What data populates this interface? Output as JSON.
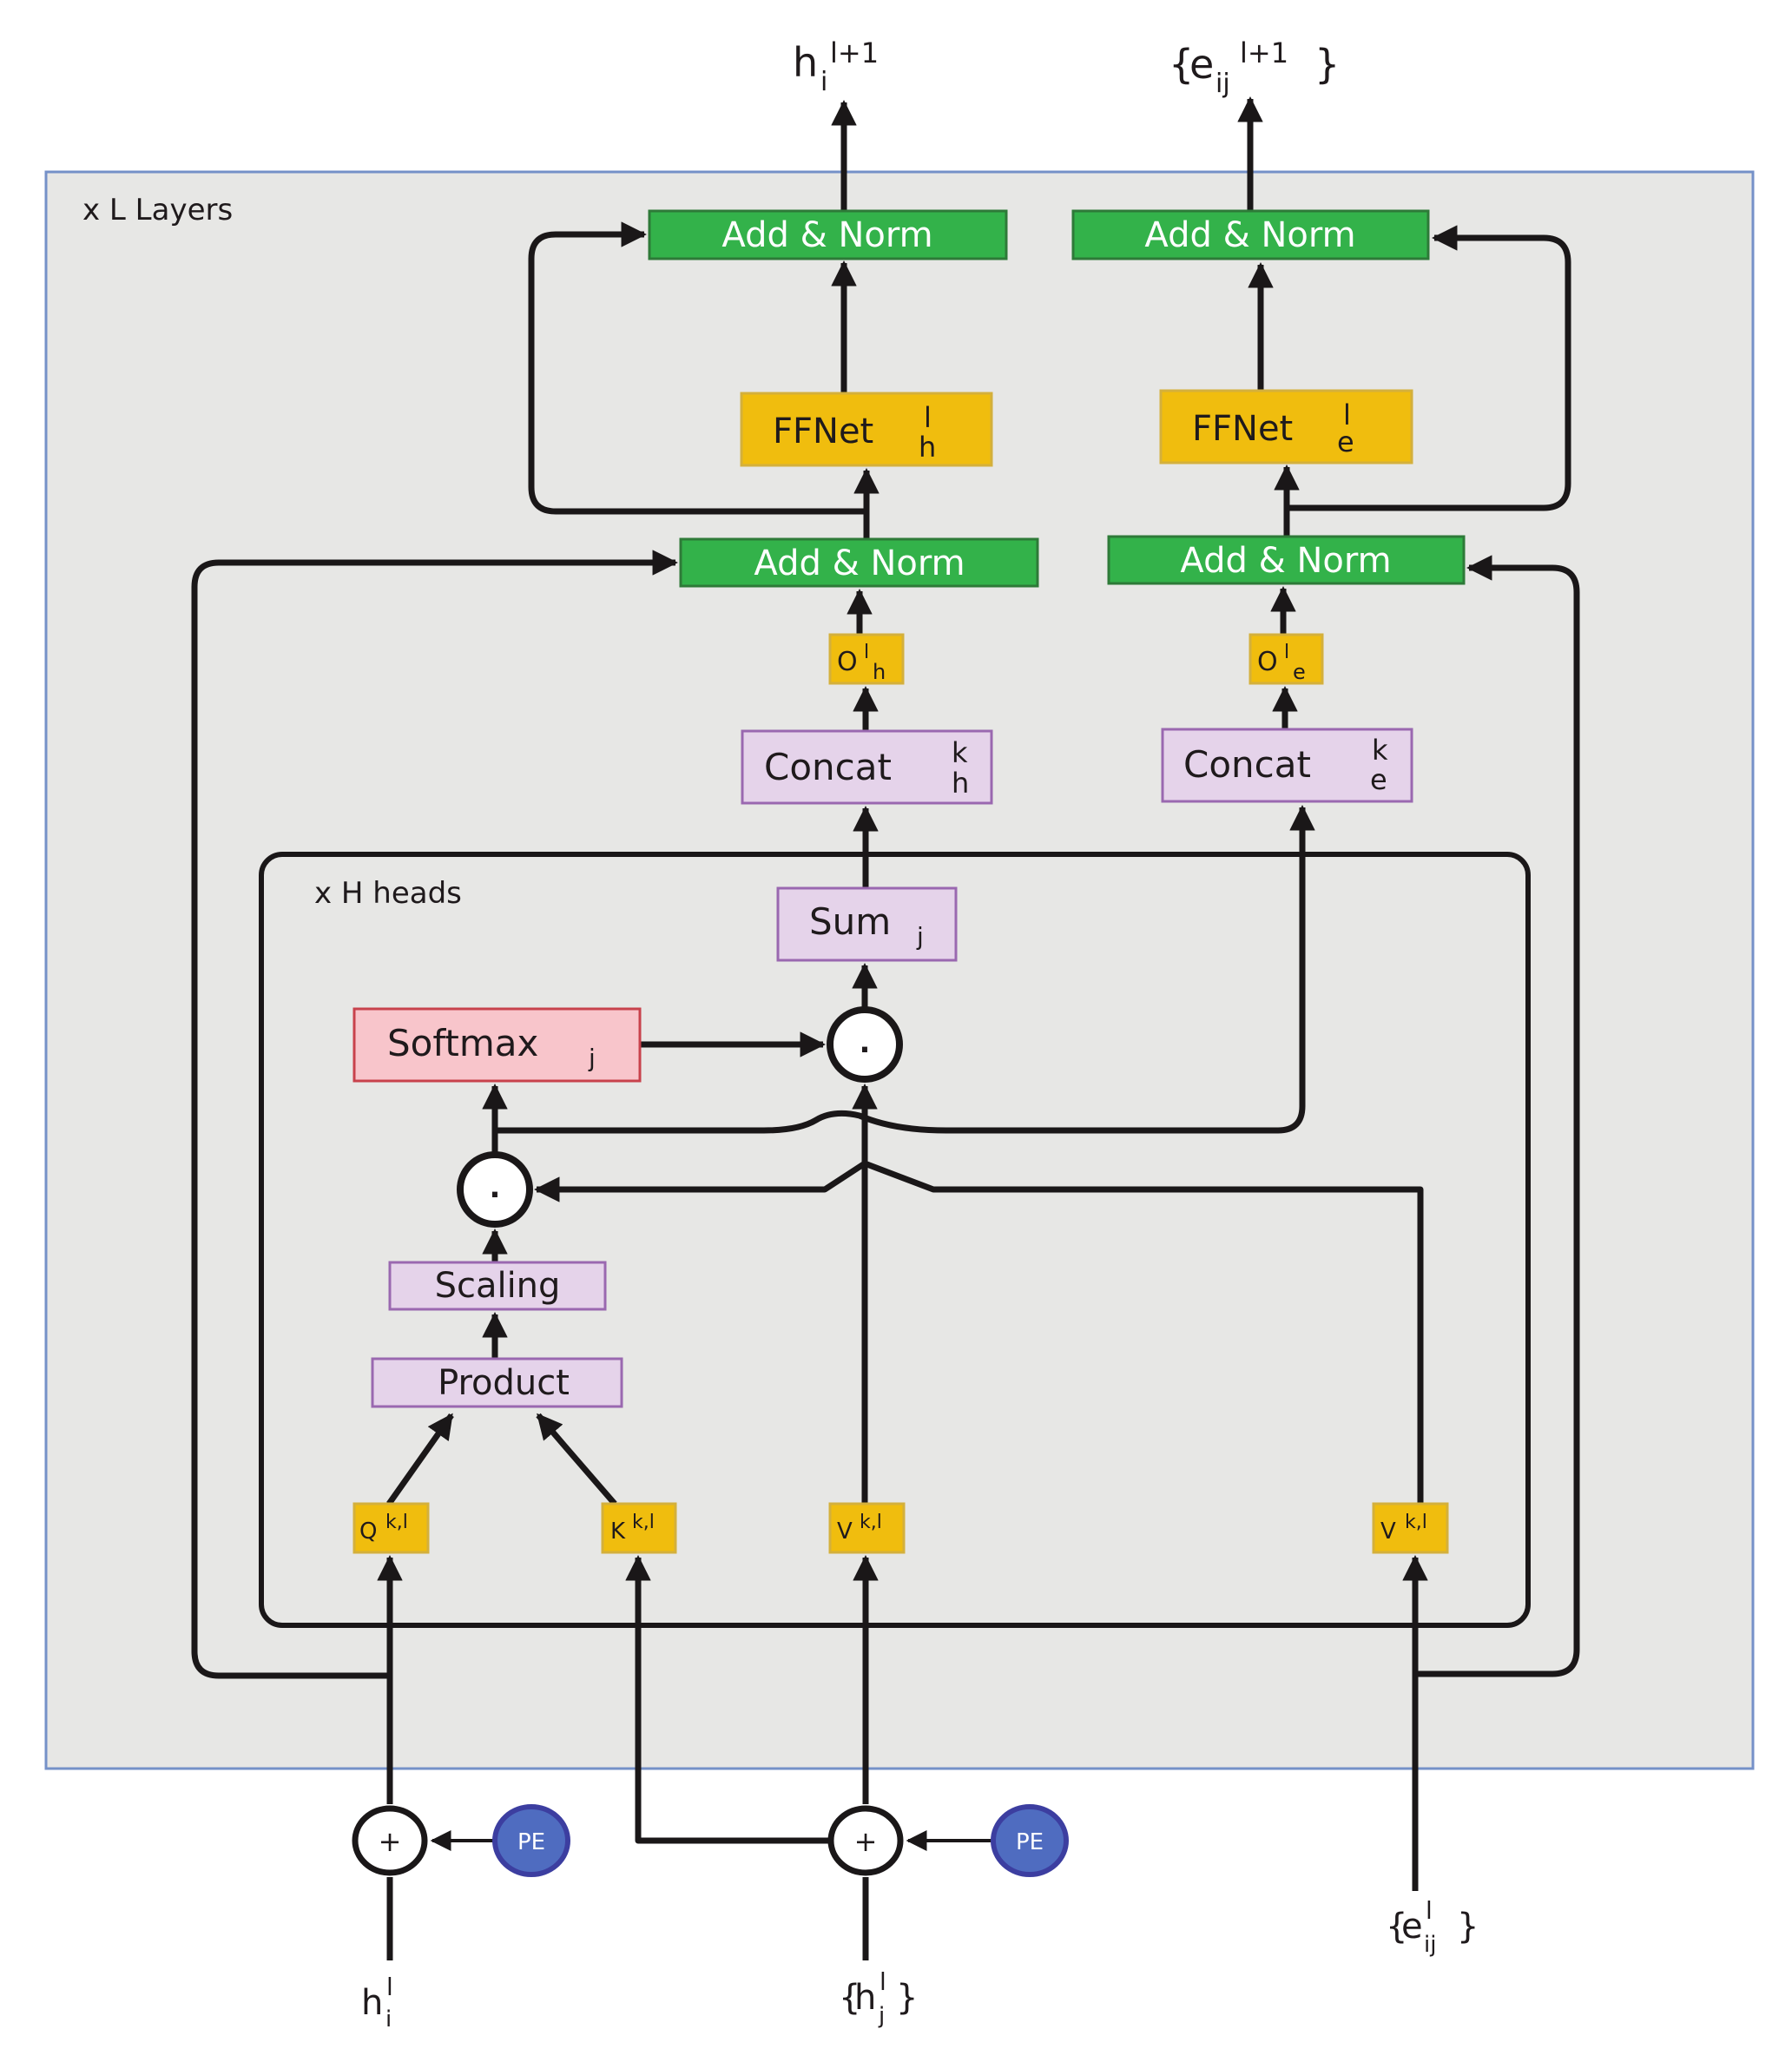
{
  "colors": {
    "canvas": "#ffffff",
    "layer_fill": "#e7e7e5",
    "layer_border": "#7591c8",
    "green_fill": "#33b24a",
    "green_border": "#2e7a38",
    "yellow_fill": "#f0bd0e",
    "yellow_border": "#d4b03c",
    "purple_fill": "#e5d3ea",
    "purple_border": "#9a68b0",
    "red_fill": "#f8c5cb",
    "red_border": "#c8424c",
    "pe_fill": "#4f6cc0",
    "pe_border": "#3c3ea0",
    "line": "#1a1718"
  },
  "frames": {
    "layers_label": "x L  Layers",
    "heads_label": "x H heads"
  },
  "outputs": {
    "node": {
      "base": "h",
      "sub": "i",
      "sup": "l+1"
    },
    "edge": {
      "open": "{",
      "base": "e",
      "sub": "ij",
      "sup": "l+1",
      "close": "}"
    }
  },
  "inputs": {
    "node_i": {
      "base": "h",
      "sub": "i",
      "sup": "l"
    },
    "node_j": {
      "open": "{",
      "base": "h",
      "sub": "j",
      "sup": "l",
      "close": "}"
    },
    "edge": {
      "open": "{",
      "base": "e",
      "sub": "ij",
      "sup": "l",
      "close": "}"
    }
  },
  "blocks": {
    "add_norm_top_h": "Add & Norm",
    "add_norm_top_e": "Add & Norm",
    "add_norm_mid_h": "Add & Norm",
    "add_norm_mid_e": "Add & Norm",
    "ffnet_h": {
      "base": "FFNet",
      "sup": "l",
      "sub": "h"
    },
    "ffnet_e": {
      "base": "FFNet",
      "sup": "l",
      "sub": "e"
    },
    "o_h": {
      "base": "O",
      "sup": "l",
      "sub": "h"
    },
    "o_e": {
      "base": "O",
      "sup": "l",
      "sub": "e"
    },
    "concat_h": {
      "base": "Concat",
      "sup": "k",
      "sub": "h"
    },
    "concat_e": {
      "base": "Concat",
      "sup": "k",
      "sub": "e"
    },
    "sum": {
      "base": "Sum",
      "sub": "j"
    },
    "softmax": {
      "base": "Softmax",
      "sub": "j"
    },
    "scaling": "Scaling",
    "product": "Product",
    "q": {
      "base": "Q",
      "sup": "k,l"
    },
    "k": {
      "base": "K",
      "sup": "k,l"
    },
    "v_node": {
      "base": "V",
      "sup": "k,l"
    },
    "v_edge": {
      "base": "V",
      "sup": "k,l"
    }
  },
  "operators": {
    "dot": ".",
    "plus": "+",
    "pe": "PE"
  }
}
